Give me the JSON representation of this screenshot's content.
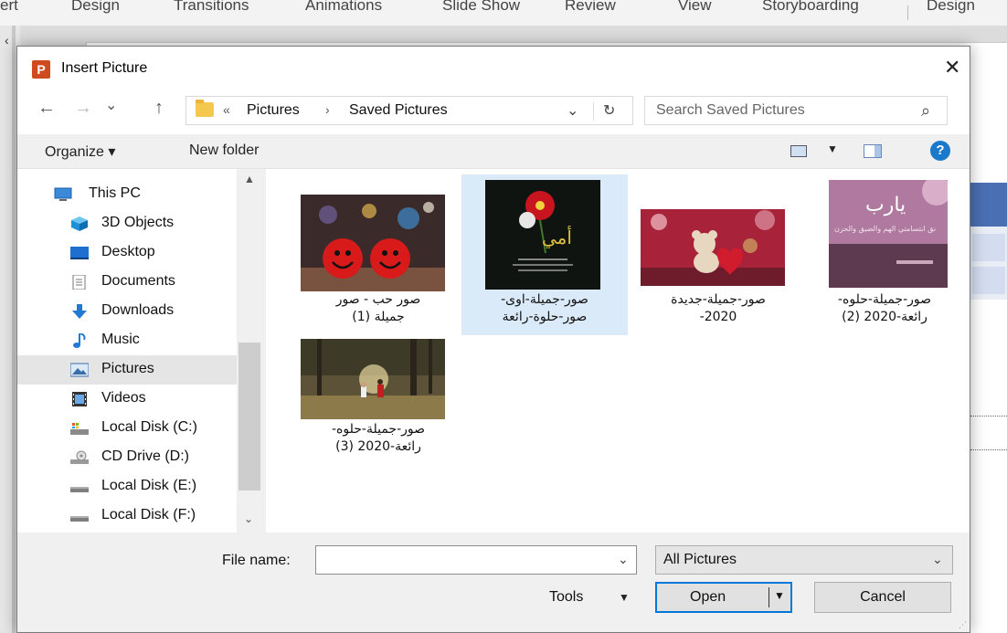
{
  "ribbon": {
    "tabs": [
      "ert",
      "Design",
      "Transitions",
      "Animations",
      "Slide Show",
      "Review",
      "View",
      "Storyboarding",
      "Design"
    ]
  },
  "dialog": {
    "title": "Insert Picture",
    "app_icon_letter": "P",
    "close_glyph": "✕"
  },
  "nav": {
    "back": "←",
    "forward": "→",
    "recent": "⌄",
    "up": "↑",
    "breadcrumb_overflow": "«",
    "breadcrumb": [
      "Pictures",
      "Saved Pictures"
    ],
    "breadcrumb_sep": "›",
    "dropdown": "⌄",
    "refresh": "↻",
    "search_placeholder": "Search Saved Pictures",
    "search_icon": "⌕"
  },
  "commands": {
    "organize": "Organize ▾",
    "new_folder": "New folder",
    "view_dropdown": "▼",
    "help": "?"
  },
  "sidebar": {
    "items": [
      {
        "label": "This PC",
        "icon": "pc-icon"
      },
      {
        "label": "3D Objects",
        "icon": "3d-objects-icon"
      },
      {
        "label": "Desktop",
        "icon": "desktop-icon"
      },
      {
        "label": "Documents",
        "icon": "documents-icon"
      },
      {
        "label": "Downloads",
        "icon": "downloads-icon"
      },
      {
        "label": "Music",
        "icon": "music-icon"
      },
      {
        "label": "Pictures",
        "icon": "pictures-icon",
        "selected": true
      },
      {
        "label": "Videos",
        "icon": "videos-icon"
      },
      {
        "label": "Local Disk (C:)",
        "icon": "drive-c-icon"
      },
      {
        "label": "CD Drive (D:)",
        "icon": "cd-drive-icon"
      },
      {
        "label": "Local Disk (E:)",
        "icon": "drive-icon"
      },
      {
        "label": "Local Disk (F:)",
        "icon": "drive-icon"
      }
    ],
    "scroll_up": "▲",
    "scroll_down": "⌄"
  },
  "files": [
    {
      "line1": "صور حب - صور",
      "line2": "(1) جميلة",
      "selected": false
    },
    {
      "line1": "-صور-جميلة-اوى",
      "line2": "صور-حلوة-رائعة",
      "selected": true
    },
    {
      "line1": "صور-جميلة-جديدة",
      "line2": "-2020",
      "selected": false
    },
    {
      "line1": "-صور-جميلة-حلوه",
      "line2": "(2) رائعة-2020",
      "selected": false
    },
    {
      "line1": "-صور-جميلة-حلوه",
      "line2": "(3) رائعة-2020",
      "selected": false
    }
  ],
  "bottom": {
    "file_name_label": "File name:",
    "file_name_value": "",
    "file_name_dropdown": "⌄",
    "file_type": "All Pictures",
    "file_type_dropdown": "⌄",
    "tools_label": "Tools",
    "tools_dropdown": "▼",
    "open_label": "Open",
    "open_dropdown": "▼",
    "cancel_label": "Cancel"
  },
  "colors": {
    "accent": "#0078d7",
    "selection": "#dbeaf8",
    "help": "#1979ca"
  }
}
